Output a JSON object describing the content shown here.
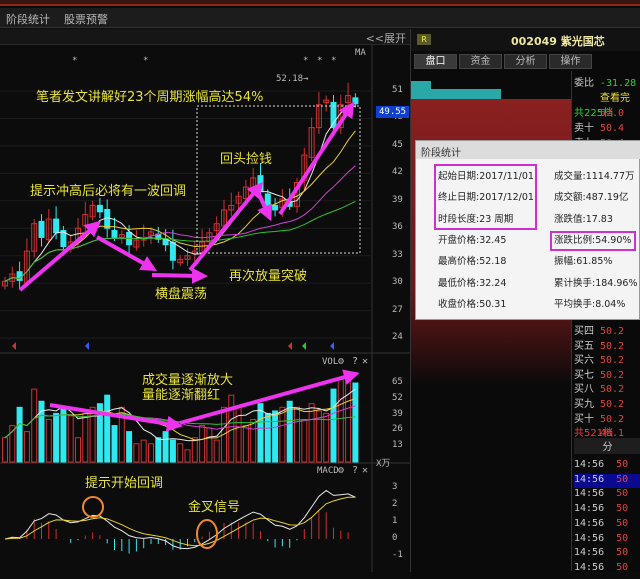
{
  "menu": {
    "items": [
      "阶段统计",
      "股票预警"
    ],
    "expand": "<<展开"
  },
  "chart": {
    "ma_label": "MA",
    "stars": [
      "*",
      "*",
      "*",
      "*",
      "*"
    ],
    "high_label": "52.18→",
    "price_ticks": [
      51,
      48,
      45,
      42,
      39,
      36,
      33,
      30,
      27,
      24
    ],
    "current_price": "49.55",
    "vol_label": "VOL",
    "vol_ticks": [
      65,
      52,
      39,
      26,
      13
    ],
    "vol_unit": "X万",
    "macd_label": "MACD",
    "macd_ticks": [
      3,
      2,
      1,
      0,
      -1
    ],
    "panel_icons": [
      "⚙",
      "?",
      "✕"
    ],
    "closes": [
      30.2,
      31,
      30.3,
      33.5,
      36.5,
      35,
      37,
      35.5,
      34,
      34.5,
      36,
      37.5,
      38.5,
      37.8,
      36,
      35,
      35.3,
      34.2,
      34.7,
      35,
      35.6,
      34.8,
      34.2,
      32.5,
      32.6,
      33,
      33.5,
      34.5,
      35.5,
      36.5,
      38,
      38.5,
      39.5,
      40.5,
      41.5,
      40,
      38.5,
      38,
      39.2,
      38.4,
      41,
      44,
      47,
      49.5,
      50,
      47,
      49.5,
      50.5,
      49.6
    ],
    "volumes": [
      20,
      30,
      45,
      25,
      60,
      50,
      35,
      40,
      45,
      38,
      20,
      40,
      45,
      48,
      55,
      30,
      45,
      25,
      15,
      18,
      15,
      20,
      25,
      18,
      15,
      10,
      20,
      30,
      28,
      18,
      45,
      55,
      45,
      30,
      35,
      48,
      40,
      42,
      45,
      50,
      45,
      35,
      48,
      42,
      40,
      60,
      68,
      68,
      65
    ],
    "annotations": {
      "title": "笔者发文讲解好23个周期涨幅高达54%",
      "pullback": "提示冲高后必将有一波回调",
      "sideways": "横盘震荡",
      "pickup": "回头捡钱",
      "breakout": "再次放量突破",
      "vol1": "成交量逐渐放大",
      "vol2": "量能逐渐翻红",
      "macd_pullback": "提示开始回调",
      "golden_cross": "金叉信号"
    }
  },
  "right": {
    "badge": "R",
    "title": "002049 紫光国芯",
    "tabs": [
      "盘口",
      "资金",
      "分析",
      "操作"
    ],
    "orderbook_top": [
      {
        "l": "委比",
        "v": "-31.28"
      },
      {
        "l": "",
        "v": "查看完"
      },
      {
        "l": "共225档",
        "v": "52.0"
      },
      {
        "l": "卖十",
        "v": "50.4"
      },
      {
        "l": "卖九",
        "v": "50.4"
      }
    ],
    "orderbook_bottom": [
      {
        "l": "买四",
        "v": "50.2"
      },
      {
        "l": "买五",
        "v": "50.2"
      },
      {
        "l": "买六",
        "v": "50.2"
      },
      {
        "l": "买七",
        "v": "50.2"
      },
      {
        "l": "买八",
        "v": "50.2"
      },
      {
        "l": "买九",
        "v": "50.2"
      },
      {
        "l": "买十",
        "v": "50.2"
      },
      {
        "l": "共521档",
        "v": "48.1"
      }
    ],
    "ticks_header": "分",
    "ticks": [
      "14:56",
      "14:56",
      "14:56",
      "14:56",
      "14:56",
      "14:56",
      "14:56",
      "14:56"
    ],
    "tick_values": [
      "50",
      "50",
      "50",
      "50",
      "50",
      "50",
      "50",
      "50"
    ]
  },
  "popup": {
    "title": "阶段统计",
    "left": [
      "起始日期:2017/11/01",
      "终止日期:2017/12/01",
      "时段长度:23 周期",
      "开盘价格:32.45",
      "最高价格:52.18",
      "最低价格:32.24",
      "收盘价格:50.31"
    ],
    "right": [
      "成交量:1114.77万",
      "成交额:487.19亿",
      "涨跌值:17.83",
      "涨跌比例:54.90%",
      "振幅:61.85%",
      "累计换手:184.96%",
      "平均换手:8.04%"
    ]
  },
  "colors": {
    "up": "#d03030",
    "down": "#30e8f0",
    "ma5": "#e8e8e8",
    "ma10": "#e8d030",
    "ma20": "#d040d0",
    "ma60": "#30c030",
    "arrow": "#ee33ee",
    "annotation": "#e8e23a"
  }
}
